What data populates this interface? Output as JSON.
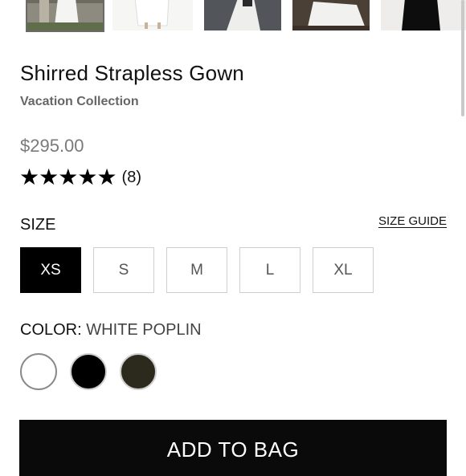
{
  "product": {
    "title": "Shirred Strapless Gown",
    "collection": "Vacation Collection",
    "price": "$295.00",
    "rating": {
      "stars": 5,
      "count_label": "(8)"
    }
  },
  "size": {
    "label": "SIZE",
    "guide_label": "SIZE GUIDE",
    "options": [
      "XS",
      "S",
      "M",
      "L",
      "XL"
    ],
    "selected": "XS"
  },
  "color": {
    "label": "COLOR:",
    "selected_name": "WHITE POPLIN",
    "swatches": [
      {
        "name": "white",
        "color": "#ffffff",
        "selected": true
      },
      {
        "name": "black",
        "color": "#000000",
        "selected": false
      },
      {
        "name": "olive",
        "color": "#2c2a1d",
        "selected": false
      }
    ]
  },
  "cta": {
    "add_to_bag_label": "ADD TO BAG"
  },
  "icons": {
    "star": "star-icon"
  },
  "colors": {
    "accent": "#000000",
    "muted_text": "#7a7a7a",
    "border": "#cfcfcf"
  }
}
